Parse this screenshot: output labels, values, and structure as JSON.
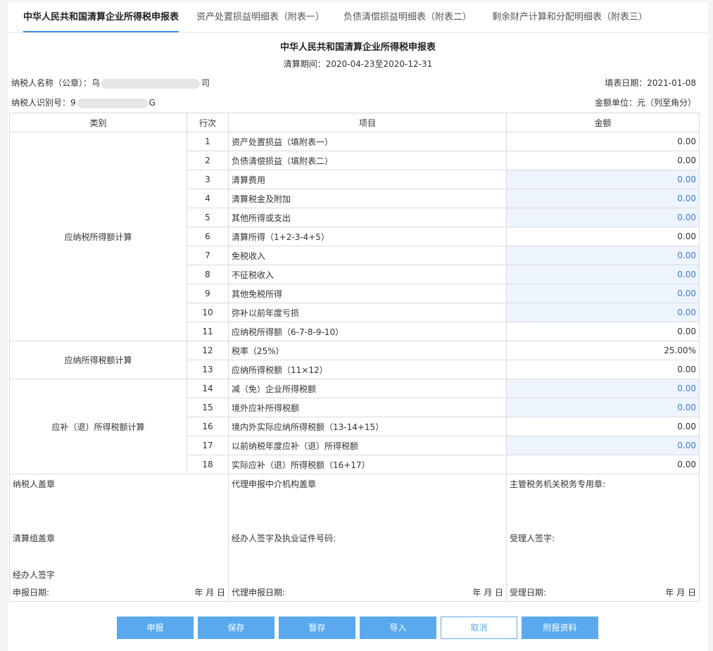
{
  "tabs": [
    {
      "label": "中华人民共和国清算企业所得税申报表",
      "active": true
    },
    {
      "label": "资产处置损益明细表（附表一）",
      "active": false
    },
    {
      "label": "负债清偿损益明细表（附表二）",
      "active": false
    },
    {
      "label": "剩余财产计算和分配明细表（附表三）",
      "active": false
    }
  ],
  "form": {
    "title": "中华人民共和国清算企业所得税申报表",
    "period": "清算期间：2020-04-23至2020-12-31",
    "taxpayer_name_label": "纳税人名称（公章）：",
    "taxpayer_name_prefix": "乌",
    "taxpayer_name_suffix": "司",
    "fill_date": "填表日期：2021-01-08",
    "taxpayer_id_label": "纳税人识别号：",
    "taxpayer_id_prefix": "9",
    "taxpayer_id_suffix": "G",
    "amount_unit": "金额单位：元（列至角分）"
  },
  "table": {
    "headers": {
      "category": "类别",
      "row_no": "行次",
      "item": "项目",
      "amount": "金额"
    },
    "categories": [
      "应纳税所得额计算",
      "应纳所得税额计算",
      "应补（退）所得税额计算"
    ],
    "rows": [
      {
        "no": "1",
        "item": "资产处置损益（填附表一）",
        "amount": "0.00",
        "editable": false
      },
      {
        "no": "2",
        "item": "负债清偿损益（填附表二）",
        "amount": "0.00",
        "editable": false
      },
      {
        "no": "3",
        "item": "清算费用",
        "amount": "0.00",
        "editable": true
      },
      {
        "no": "4",
        "item": "清算税金及附加",
        "amount": "0.00",
        "editable": true
      },
      {
        "no": "5",
        "item": "其他所得或支出",
        "amount": "0.00",
        "editable": true
      },
      {
        "no": "6",
        "item": "清算所得（1+2-3-4+5）",
        "amount": "0.00",
        "editable": false
      },
      {
        "no": "7",
        "item": "免税收入",
        "amount": "0.00",
        "editable": true
      },
      {
        "no": "8",
        "item": "不征税收入",
        "amount": "0.00",
        "editable": true
      },
      {
        "no": "9",
        "item": "其他免税所得",
        "amount": "0.00",
        "editable": true
      },
      {
        "no": "10",
        "item": "弥补以前年度亏损",
        "amount": "0.00",
        "editable": true
      },
      {
        "no": "11",
        "item": "应纳税所得额（6-7-8-9-10）",
        "amount": "0.00",
        "editable": false
      },
      {
        "no": "12",
        "item": "税率（25%）",
        "amount": "25.00%",
        "editable": false
      },
      {
        "no": "13",
        "item": "应纳所得税额（11×12）",
        "amount": "0.00",
        "editable": false
      },
      {
        "no": "14",
        "item": "减（免）企业所得税额",
        "amount": "0.00",
        "editable": true
      },
      {
        "no": "15",
        "item": "境外应补所得税额",
        "amount": "0.00",
        "editable": true
      },
      {
        "no": "16",
        "item": "境内外实际应纳所得税额（13-14+15）",
        "amount": "0.00",
        "editable": false
      },
      {
        "no": "17",
        "item": "以前纳税年度应补（退）所得税额",
        "amount": "0.00",
        "editable": true
      },
      {
        "no": "18",
        "item": "实际应补（退）所得税额（16+17）",
        "amount": "0.00",
        "editable": false
      }
    ]
  },
  "signature": {
    "col1": {
      "seal": "纳税人盖章",
      "group_seal": "清算组盖章",
      "agent_sign": "经办人签字",
      "date_label": "申报日期:",
      "date_value": "年 月 日"
    },
    "col2": {
      "seal": "代理申报中介机构盖章",
      "sign": "经办人签字及执业证件号码:",
      "date_label": "代理申报日期:",
      "date_value": "年 月 日"
    },
    "col3": {
      "seal": "主管税务机关税务专用章:",
      "sign": "受理人签字:",
      "date_label": "受理日期:",
      "date_value": "年 月 日"
    }
  },
  "buttons": [
    {
      "label": "申报",
      "style": "primary"
    },
    {
      "label": "保存",
      "style": "primary"
    },
    {
      "label": "暂存",
      "style": "primary"
    },
    {
      "label": "导入",
      "style": "primary"
    },
    {
      "label": "取消",
      "style": "ghost"
    },
    {
      "label": "附报资料",
      "style": "primary"
    }
  ],
  "colors": {
    "accent": "#5aa9ee",
    "editable_bg": "#eef4fd",
    "editable_text": "#3a7fd5",
    "border": "#d7dbe0"
  }
}
